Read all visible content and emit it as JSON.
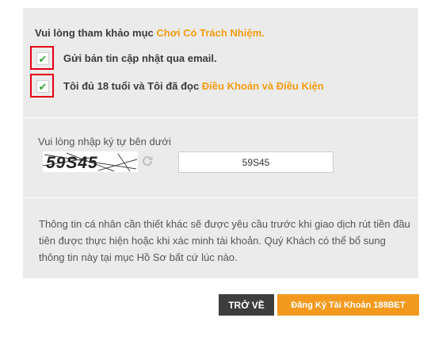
{
  "responsible": {
    "prefix": "Vui lòng tham khảo mục ",
    "link": "Chơi Có Trách Nhiệm."
  },
  "checkboxes": [
    {
      "label": "Gửi bản tin cập nhật qua email.",
      "checked": true
    },
    {
      "label": "Tôi đủ 18 tuổi và Tôi đã đọc ",
      "link": "Điều Khoản và Điều Kiện",
      "checked": true
    }
  ],
  "check_glyph": "✔",
  "captcha": {
    "label": "Vui lòng nhập ký tự bên dưới",
    "image_text": "59S45",
    "input_value": "59S45",
    "refresh_icon": "refresh-icon"
  },
  "info": "Thông tin cá nhân cần thiết khác sẽ được yêu cầu trước khi giao dịch rút tiền đầu tiên được thực hiện hoặc khi xác minh tài khoản. Quý Khách có thể bổ sung thông tin này tại mục Hồ Sơ bất cứ lúc nào.",
  "buttons": {
    "back": "TRỞ VỀ",
    "register": "Đăng Ký Tài Khoản 188BET"
  },
  "colors": {
    "link": "#f39c12",
    "highlight_border": "#e60012",
    "check": "#3aa63a",
    "back_button": "#3d3d3d",
    "register_button": "#f39a1e"
  }
}
